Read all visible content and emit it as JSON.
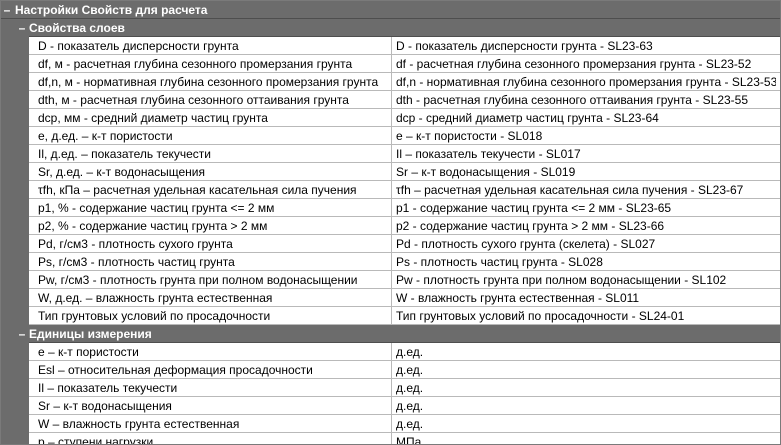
{
  "root": {
    "toggle": "–",
    "title": "Настройки Свойств для расчета"
  },
  "sections": [
    {
      "toggle": "–",
      "title": "Свойства слоев",
      "rows": [
        {
          "name": "D - показатель дисперсности грунта",
          "value": "D - показатель дисперсности грунта - SL23-63"
        },
        {
          "name": "df, м - расчетная глубина сезонного промерзания грунта",
          "value": "df - расчетная глубина сезонного промерзания грунта - SL23-52"
        },
        {
          "name": "df,n, м - нормативная глубина сезонного промерзания грунта",
          "value": "df,n - нормативная глубина сезонного промерзания грунта - SL23-53"
        },
        {
          "name": "dth, м - расчетная глубина сезонного оттаивания грунта",
          "value": "dth - расчетная глубина сезонного оттаивания грунта - SL23-55"
        },
        {
          "name": "dcp, мм - средний диаметр частиц грунта",
          "value": "dcp - средний диаметр частиц грунта - SL23-64"
        },
        {
          "name": "е, д.ед. – к-т пористости",
          "value": "е – к-т пористости - SL018"
        },
        {
          "name": "Il, д.ед. – показатель текучести",
          "value": "Il – показатель текучести - SL017"
        },
        {
          "name": "Sr, д.ед. – к-т водонасыщения",
          "value": "Sr – к-т водонасыщения - SL019"
        },
        {
          "name": "τfh, кПа – расчетная удельная касательная сила пучения",
          "value": "τfh – расчетная удельная касательная сила пучения - SL23-67"
        },
        {
          "name": "p1, % - содержание частиц грунта <= 2 мм",
          "value": "p1 - содержание частиц грунта <= 2 мм - SL23-65"
        },
        {
          "name": "p2, % - содержание частиц грунта > 2 мм",
          "value": "p2 - содержание частиц грунта > 2 мм - SL23-66"
        },
        {
          "name": "Pd, г/см3 - плотность сухого грунта",
          "value": "Pd - плотность сухого грунта (скелета) - SL027"
        },
        {
          "name": "Ps, г/см3 - плотность частиц грунта",
          "value": "Ps - плотность частиц грунта - SL028"
        },
        {
          "name": "Pw, г/см3 - плотность грунта при полном водонасыщении",
          "value": "Pw - плотность грунта при полном водонасыщении - SL102"
        },
        {
          "name": "W, д.ед. – влажность грунта естественная",
          "value": "W - влажность грунта естественная - SL011"
        },
        {
          "name": "Тип грунтовых условий по просадочности",
          "value": "Тип грунтовых условий по просадочности - SL24-01"
        }
      ]
    },
    {
      "toggle": "–",
      "title": "Единицы измерения",
      "rows": [
        {
          "name": "е – к-т пористости",
          "value": "д.ед."
        },
        {
          "name": "Esl – относительная деформация просадочности",
          "value": "д.ед."
        },
        {
          "name": "Il – показатель текучести",
          "value": "д.ед."
        },
        {
          "name": "Sr – к-т водонасыщения",
          "value": "д.ед."
        },
        {
          "name": "W – влажность грунта естественная",
          "value": "д.ед."
        },
        {
          "name": "р – ступени нагрузки",
          "value": "МПа"
        }
      ]
    }
  ]
}
